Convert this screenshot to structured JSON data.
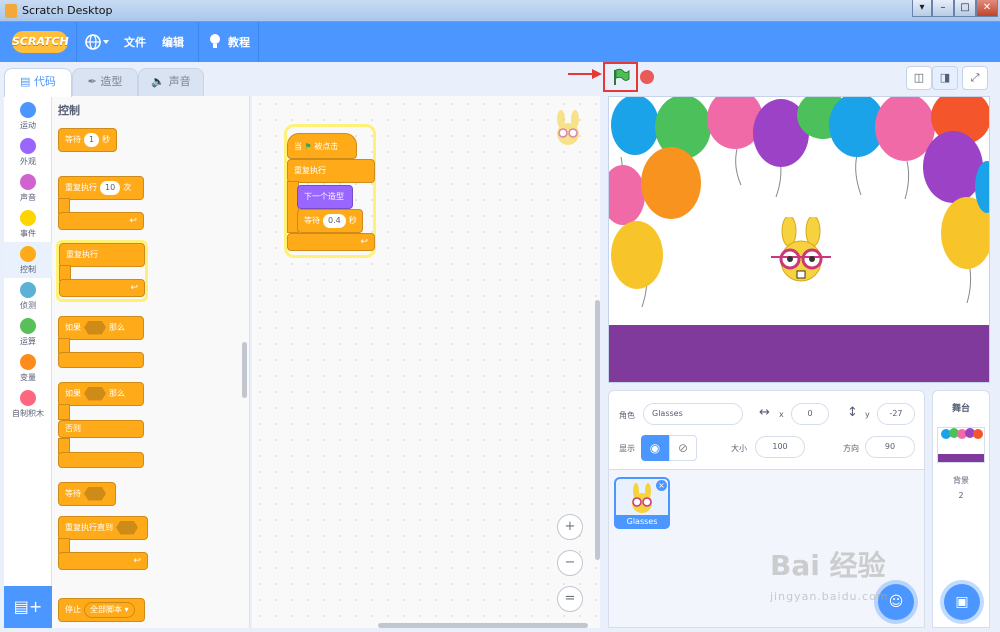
{
  "window": {
    "title": "Scratch Desktop",
    "controls": [
      "▾",
      "–",
      "□",
      "✕"
    ]
  },
  "menu": {
    "logo": "SCRATCH",
    "language_icon": "globe-icon",
    "file": "文件",
    "edit": "编辑",
    "tutorials": "教程"
  },
  "tabs": [
    {
      "label": "代码",
      "active": true
    },
    {
      "label": "造型",
      "active": false
    },
    {
      "label": "声音",
      "active": false
    }
  ],
  "categories": [
    {
      "label": "运动",
      "color": "#4c97ff"
    },
    {
      "label": "外观",
      "color": "#9966ff"
    },
    {
      "label": "声音",
      "color": "#cf63cf"
    },
    {
      "label": "事件",
      "color": "#ffd500"
    },
    {
      "label": "控制",
      "color": "#ffab19",
      "selected": true
    },
    {
      "label": "侦测",
      "color": "#5cb1d6"
    },
    {
      "label": "运算",
      "color": "#59c059"
    },
    {
      "label": "变量",
      "color": "#ff8c1a"
    },
    {
      "label": "自制积木",
      "color": "#ff6680"
    }
  ],
  "palette": {
    "title": "控制",
    "wait": {
      "label": "等待",
      "value": "1",
      "unit": "秒"
    },
    "repeat": {
      "label": "重复执行",
      "value": "10",
      "unit": "次"
    },
    "forever": {
      "label": "重复执行"
    },
    "if_then": {
      "if": "如果",
      "then": "那么"
    },
    "if_else": {
      "if": "如果",
      "then": "那么",
      "else": "否则"
    },
    "wait_until": {
      "label": "等待"
    },
    "repeat_until": {
      "label": "重复执行直到"
    },
    "stop": {
      "label": "停止",
      "option": "全部脚本 ▾"
    }
  },
  "script": {
    "hat_when": "当",
    "hat_clicked": "被点击",
    "forever": "重复执行",
    "next_costume": "下一个造型",
    "wait": "等待",
    "wait_value": "0.4",
    "wait_unit": "秒"
  },
  "zoom": [
    "+",
    "−",
    "="
  ],
  "sprite_info": {
    "sprite_label": "角色",
    "sprite_name": "Glasses",
    "x_label": "x",
    "x": "0",
    "y_label": "y",
    "y": "-27",
    "show_label": "显示",
    "size_label": "大小",
    "size": "100",
    "direction_label": "方向",
    "direction": "90"
  },
  "sprites": [
    {
      "name": "Glasses"
    }
  ],
  "stage_panel": {
    "title": "舞台",
    "backdrops_label": "背景",
    "backdrops_count": "2"
  },
  "watermark": {
    "main": "Bai 经验",
    "sub": "jingyan.baidu.com"
  },
  "colors": {
    "accent": "#4c97ff",
    "control": "#ffab19",
    "looks": "#9966ff",
    "stage_floor": "#7f3a9c"
  }
}
